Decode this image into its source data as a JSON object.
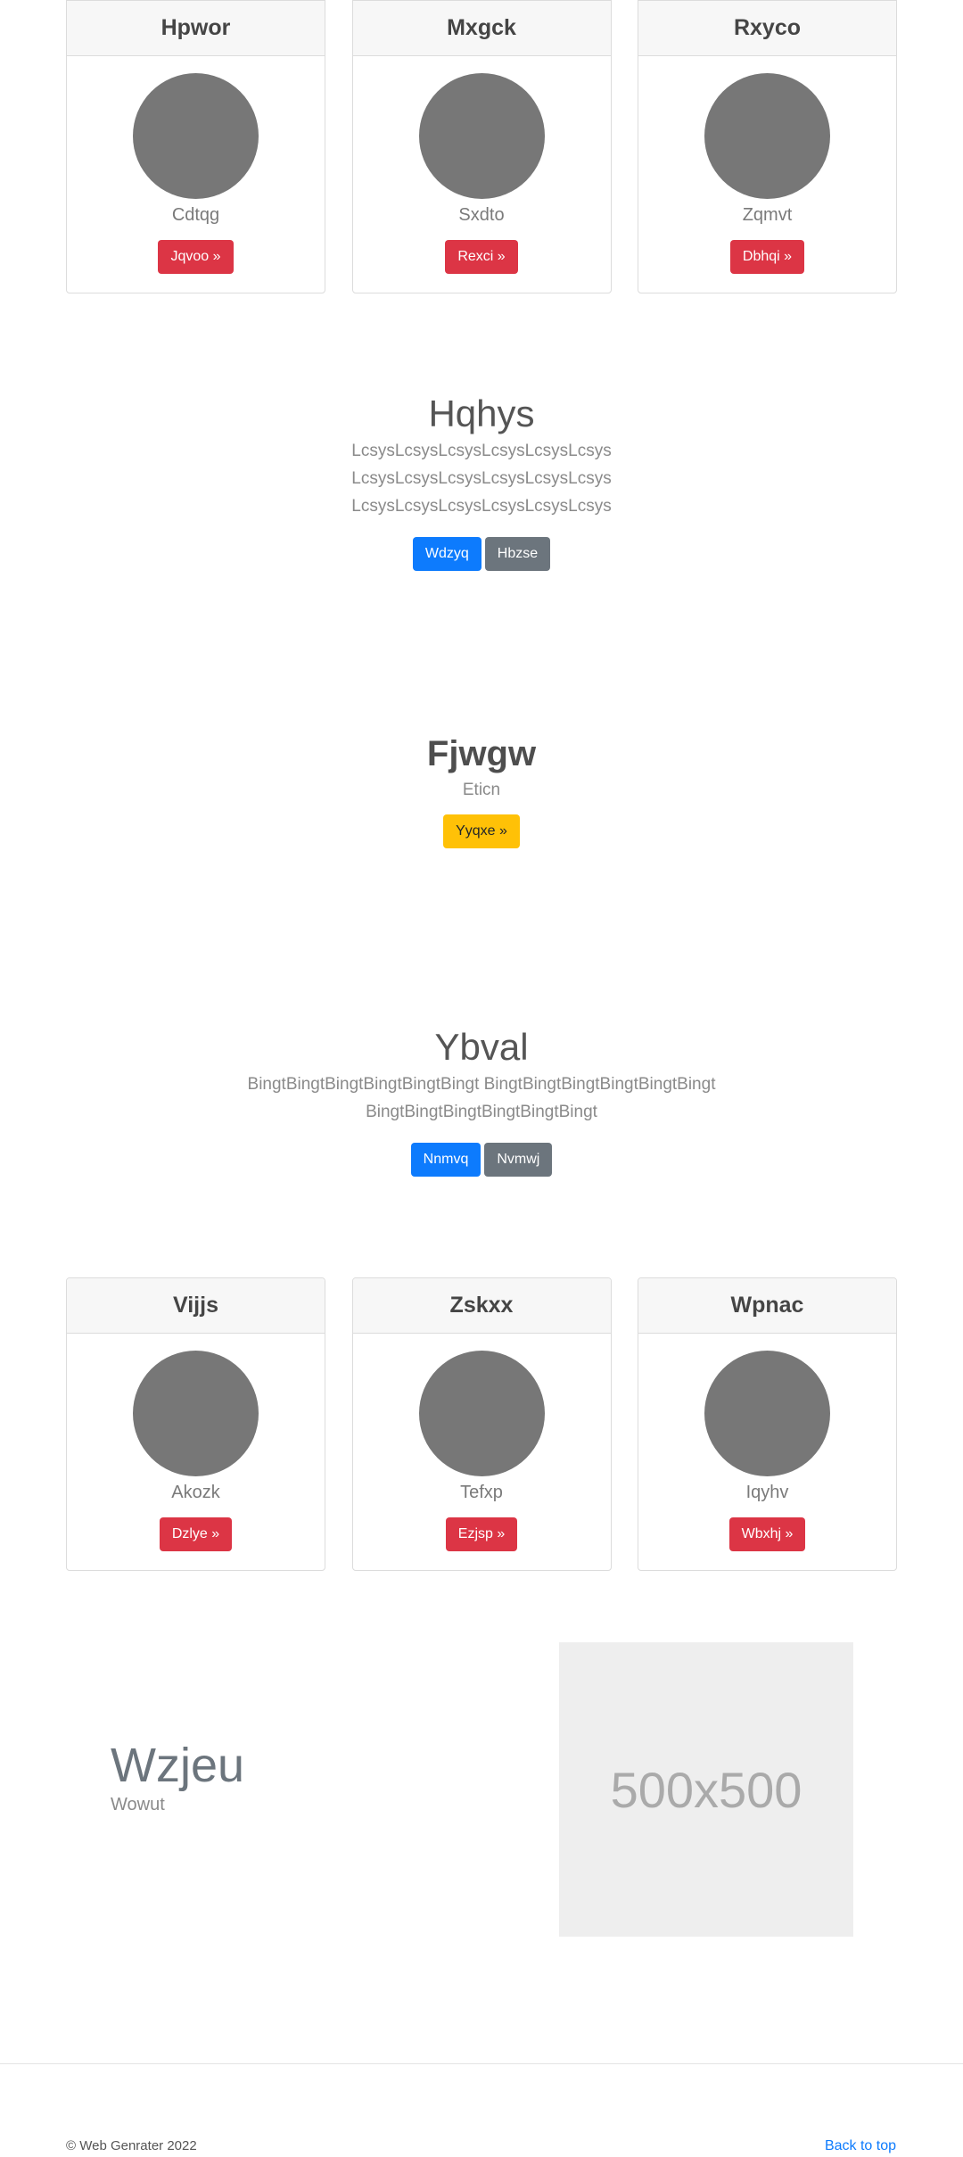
{
  "cards_top": [
    {
      "title": "Hpwor",
      "text": "Cdtqg",
      "button": "Jqvoo »"
    },
    {
      "title": "Mxgck",
      "text": "Sxdto",
      "button": "Rexci »"
    },
    {
      "title": "Rxyco",
      "text": "Zqmvt",
      "button": "Dbhqi »"
    }
  ],
  "jumbotron1": {
    "title": "Hqhys",
    "lead": "LcsysLcsysLcsysLcsysLcsysLcsys LcsysLcsysLcsysLcsysLcsysLcsys LcsysLcsysLcsysLcsysLcsysLcsys",
    "primary_button": "Wdzyq",
    "secondary_button": "Hbzse"
  },
  "feature": {
    "title": "Fjwgw",
    "subtitle": "Eticn",
    "button": "Yyqxe »"
  },
  "jumbotron2": {
    "title": "Ybval",
    "lead": "BingtBingtBingtBingtBingtBingt BingtBingtBingtBingtBingtBingt BingtBingtBingtBingtBingtBingt",
    "primary_button": "Nnmvq",
    "secondary_button": "Nvmwj"
  },
  "cards_bottom": [
    {
      "title": "Vijjs",
      "text": "Akozk",
      "button": "Dzlye »"
    },
    {
      "title": "Zskxx",
      "text": "Tefxp",
      "button": "Ezjsp »"
    },
    {
      "title": "Wpnac",
      "text": "Iqyhv",
      "button": "Wbxhj »"
    }
  ],
  "hero": {
    "title": "Wzjeu",
    "subtitle": "Wowut",
    "image_label": "500x500"
  },
  "footer": {
    "copyright": "© Web Genrater 2022",
    "back_to_top": "Back to top"
  },
  "colors": {
    "danger": "#dc3545",
    "primary": "#0d7bfd",
    "secondary": "#6c757d",
    "warning": "#ffc107"
  }
}
